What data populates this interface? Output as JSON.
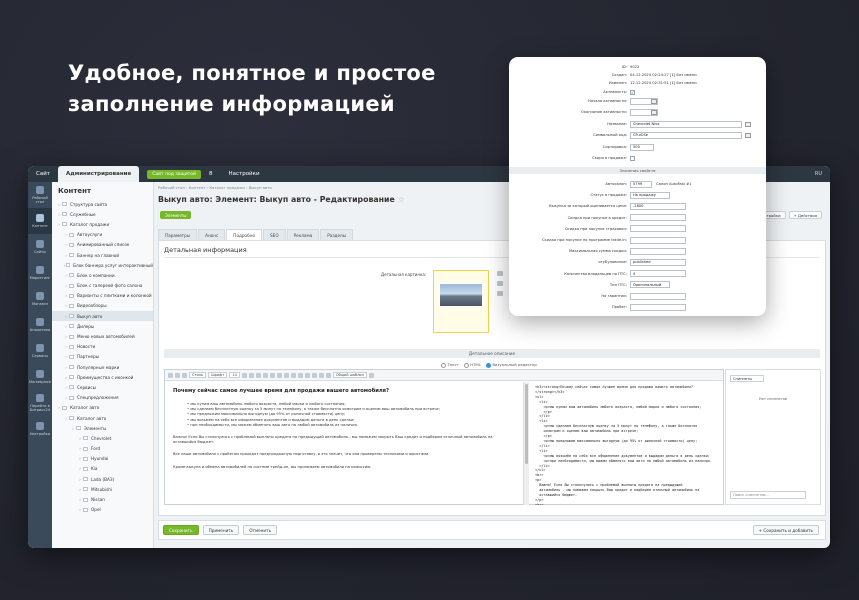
{
  "headline": [
    "Удобное, понятное и простое",
    "заполнение информацией"
  ],
  "topbar": {
    "site": "Сайт",
    "admin": "Администрирование",
    "site_protected": "Сайт под защитой",
    "counter": "8",
    "settings": "Настройки",
    "lang": "RU"
  },
  "rail": [
    "Рабочий стол",
    "Контент",
    "Сайты",
    "Маркетинг",
    "Магазин",
    "Аналитика",
    "Сервисы",
    "Marketplace",
    "Перейти в Битрикс24",
    "Настройки"
  ],
  "sidebar": {
    "title": "Контент",
    "items": [
      {
        "label": "Структура сайта",
        "indent": 0
      },
      {
        "label": "Служебные",
        "indent": 0
      },
      {
        "label": "Каталог продажи",
        "indent": 0
      },
      {
        "label": "Автоуслуги",
        "indent": 1
      },
      {
        "label": "Анимированный список",
        "indent": 1
      },
      {
        "label": "Баннер на главной",
        "indent": 1
      },
      {
        "label": "Блок баннера услуг интерактивный",
        "indent": 1
      },
      {
        "label": "Блок о компании",
        "indent": 1
      },
      {
        "label": "Блок с галереей фото салона",
        "indent": 1
      },
      {
        "label": "Варианты с плитками и колонкой",
        "indent": 1
      },
      {
        "label": "Видеообзоры",
        "indent": 1
      },
      {
        "label": "Выкуп авто",
        "indent": 1,
        "selected": true
      },
      {
        "label": "Дилеры",
        "indent": 1
      },
      {
        "label": "Меню новых автомобилей",
        "indent": 1
      },
      {
        "label": "Новости",
        "indent": 1
      },
      {
        "label": "Партнеры",
        "indent": 1
      },
      {
        "label": "Популярные марки",
        "indent": 1
      },
      {
        "label": "Преимущества с иконкой",
        "indent": 1
      },
      {
        "label": "Сервисы",
        "indent": 1
      },
      {
        "label": "Спецпредложения",
        "indent": 1
      },
      {
        "label": "Каталог авто",
        "indent": 0
      },
      {
        "label": "Каталог авто",
        "indent": 1
      },
      {
        "label": "Элементы",
        "indent": 2
      },
      {
        "label": "Chevrolet",
        "indent": 3
      },
      {
        "label": "Ford",
        "indent": 3
      },
      {
        "label": "Hyundai",
        "indent": 3
      },
      {
        "label": "Kia",
        "indent": 3
      },
      {
        "label": "Lada (ВАЗ)",
        "indent": 3
      },
      {
        "label": "Mitsubishi",
        "indent": 3
      },
      {
        "label": "Nissan",
        "indent": 3
      },
      {
        "label": "Opel",
        "indent": 3
      }
    ]
  },
  "main": {
    "breadcrumbs": "Рабочий стол  ›  Контент  ›  Каталог продажи  ›  Выкуп авто",
    "title": "Выкуп авто: Элемент: Выкуп авто - Редактирование",
    "elements_button": "Элементы",
    "actions": [
      "Настройки",
      "+ Действия"
    ],
    "tabs": [
      "Параметры",
      "Анонс",
      "Подробно",
      "SEO",
      "Реклама",
      "Разделы"
    ],
    "active_tab": 2,
    "section_title": "Детальная информация",
    "picture_label": "Детальная картинка:",
    "description_bar": "Детальное описание",
    "radios": [
      "Текст",
      "HTML",
      "Визуальный редактор"
    ],
    "editor_toolbar": {
      "style": "Стиль",
      "font": "Шрифт",
      "size": "14",
      "common": "Общий шаблон"
    },
    "editor_heading": "Почему сейчас самое лучшее время для продажи вашего автомобиля?",
    "editor_list": [
      "мы купим ваш автомобиль любого возраста, любой марки и любого состояния;",
      "мы сделаем бесплатную оценку за 5 минут по телефону, а также бесплатно осмотрим и оценим ваш автомобиль при встрече;",
      "мы предложим максимально выгодную (до 95% от рыночной стоимости) цену;",
      "мы возьмём на себя все оформление документов и выдадим деньги в день сделки;",
      "при необходимости, мы можем обменять ваш авто на любой автомобиль из наличия."
    ],
    "editor_p1": "Важно! Если Вы столкнулись с проблемой выплаты кредита на предыдущий автомобиль - мы поможем закрыть Ваш кредит и подберем отличный автомобиль на оставшийся бюджет.",
    "editor_p2": "Все наши автомобили с пробегом проходят предпродажную подготовку, а это значит, что они проверены техниками и юристами",
    "editor_p3": "Кроме выкупа и обмена автомобилей по системе трейд-ин, мы принимаем автомобили на комиссию.",
    "editor_code": "<h3><strong>Почему сейчас самое лучшее время для продажи вашего автомобиля?\n</strong></h3>\n<ul>\n  <li>\n    <p>мы купим ваш автомобиль любого возраста, любой марки и любого состояния;\n    </p>\n  </li>\n  <li>\n    <p>мы сделаем бесплатную оценку за 5 минут по телефону, а также бесплатно\n    осмотрим и оценим ваш автомобиль при встрече;\n    </p>\n    <p>мы предложим максимально выгодную (до 95% от рыночной стоимости) цену;\n  </li>\n  <li>\n    <p>мы возьмём на себя все оформление документов и выдадим деньги в день сделки;\n    <p>при необходимости, мы можем обменять ваш авто на любой автомобиль из наличия.\n  </li>\n</ul>\n<br>\n<p>\n  Важно! Если Вы столкнулись с проблемой выплаты кредита на предыдущий\n  автомобиль - мы поможем закрыть Ваш кредит и подберем отличный автомобиль на\n  оставшийся бюджет.\n</p>\n<br>\n<p>",
    "snippets_select": "Сниппеты",
    "snippets_empty": "Нет сниппетов",
    "snippets_search": "Поиск сниппетов...",
    "footer": {
      "save": "Сохранить",
      "apply": "Применить",
      "cancel": "Отменить",
      "save_add": "+ Сохранить и добавить"
    }
  },
  "overlay": {
    "id_label": "ID:",
    "id_value": "9022",
    "created_label": "Создан:",
    "created_value": "04.12.2024 02:24:27  [1] Без имени",
    "changed_label": "Изменен:",
    "changed_value": "12.12.2024 02:31:51  [1] Без имени",
    "active_label": "Активность:",
    "active_from_label": "Начало активности:",
    "active_to_label": "Окончание активности:",
    "name_label": "Название:",
    "name_value": "Chevrolet Niva",
    "code_label": "Символьный код:",
    "code_value": "CFuiOSe",
    "sort_label": "Сортировка:",
    "sort_value": "500",
    "sale_label": "Скоро в продаже:",
    "props_band": "Значения свойств",
    "props": [
      {
        "label": "Автосалон:",
        "value": "5799",
        "extra": "Салон AutoFast #1"
      },
      {
        "label": "Статус в продаже:",
        "value": "На продажу",
        "select": true
      },
      {
        "label": "Выкупка за который оценивается цена:",
        "value": "-2800"
      },
      {
        "label": "Скидка при покупке в кредит:",
        "value": ""
      },
      {
        "label": "Скидка при покупке страховки:",
        "value": ""
      },
      {
        "label": "Скидка при покупке по программе trade-in:",
        "value": ""
      },
      {
        "label": "Максимальная сумма скидки:",
        "value": ""
      },
      {
        "label": "отуБуловоние:",
        "value": "published"
      },
      {
        "label": "Количество владельцев по ПТС:",
        "value": "4"
      },
      {
        "label": "Тип ПТС:",
        "value": "Оригинальный",
        "select": true
      },
      {
        "label": "На гарантии:",
        "value": ""
      },
      {
        "label": "Пробег:",
        "value": ""
      }
    ]
  }
}
